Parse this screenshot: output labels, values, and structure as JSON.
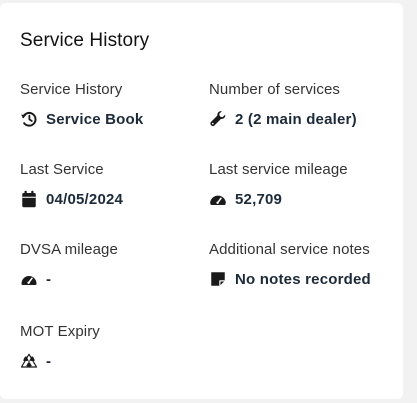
{
  "card": {
    "title": "Service History"
  },
  "fields": {
    "service_history": {
      "label": "Service History",
      "value": "Service Book",
      "icon": "history-icon"
    },
    "number_of_services": {
      "label": "Number of services",
      "value": "2 (2 main dealer)",
      "icon": "wrench-icon"
    },
    "last_service": {
      "label": "Last Service",
      "value": "04/05/2024",
      "icon": "calendar-icon"
    },
    "last_service_mileage": {
      "label": "Last service mileage",
      "value": "52,709",
      "icon": "speedometer-icon"
    },
    "dvsa_mileage": {
      "label": "DVSA mileage",
      "value": "-",
      "icon": "speedometer-icon"
    },
    "additional_service_notes": {
      "label": "Additional service notes",
      "value": "No notes recorded",
      "icon": "sticky-note-icon"
    },
    "mot_expiry": {
      "label": "MOT Expiry",
      "value": "-",
      "icon": "radiation-icon"
    }
  },
  "colors": {
    "value_text": "#1c2a3a",
    "label_text": "#333333",
    "icon": "#1a1a1a",
    "background": "#f2f2f2",
    "card": "#ffffff"
  }
}
